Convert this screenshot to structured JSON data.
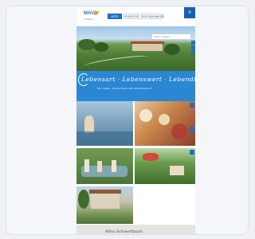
{
  "header": {
    "logo": {
      "name": "MAVA",
      "tagline": "Mallorca"
    },
    "nav": [
      {
        "label": "ARTE"
      },
      {
        "label": "EVENTOS"
      },
      {
        "label": "RESTAURANTES"
      }
    ],
    "menu_icon": "menu-icon"
  },
  "hero": {
    "search": {
      "placeholder": "Suche / Search"
    }
  },
  "banner": {
    "script": "Lebensart · Lebenswert · Lebendig",
    "subtitle": "MIT HERZ, VERSTAND UND SEHNSUCHT"
  },
  "footer": {
    "signature": "Mira Schwertbach",
    "scroll_icon": "chevron-up-icon"
  },
  "colors": {
    "accent": "#1f6fc6",
    "banner": "#2b86d4"
  }
}
